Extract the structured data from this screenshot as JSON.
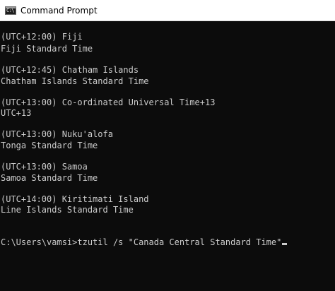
{
  "window": {
    "title": "Command Prompt",
    "icon": "cmd-icon",
    "icon_glyph": "C:\\"
  },
  "console": {
    "lines": [
      "(UTC+12:00) Fiji",
      "Fiji Standard Time",
      "(UTC+12:45) Chatham Islands",
      "Chatham Islands Standard Time",
      "(UTC+13:00) Co-ordinated Universal Time+13",
      "UTC+13",
      "(UTC+13:00) Nuku'alofa",
      "Tonga Standard Time",
      "(UTC+13:00) Samoa",
      "Samoa Standard Time",
      "(UTC+14:00) Kiritimati Island",
      "Line Islands Standard Time"
    ],
    "prompt": "C:\\Users\\vamsi>",
    "command": "tzutil /s \"Canada Central Standard Time\""
  },
  "colors": {
    "console_bg": "#0c0c0c",
    "console_fg": "#cccccc",
    "titlebar_bg": "#ffffff"
  }
}
